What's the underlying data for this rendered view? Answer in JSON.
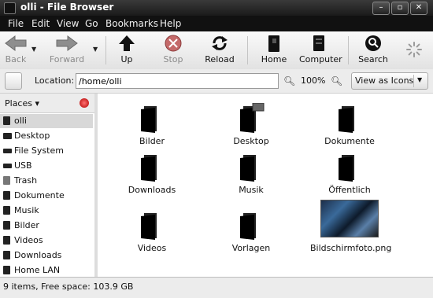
{
  "window": {
    "title": "olli - File Browser"
  },
  "menu": [
    "File",
    "Edit",
    "View",
    "Go",
    "Bookmarks",
    "Help"
  ],
  "toolbar": {
    "back": "Back",
    "forward": "Forward",
    "up": "Up",
    "stop": "Stop",
    "reload": "Reload",
    "home": "Home",
    "computer": "Computer",
    "search": "Search"
  },
  "location": {
    "label": "Location:",
    "path": "/home/olli",
    "zoom": "100%",
    "view_mode": "View as Icons"
  },
  "sidebar": {
    "header": "Places",
    "items": [
      {
        "label": "olli",
        "icon": "home-folder-icon",
        "active": true
      },
      {
        "label": "Desktop",
        "icon": "desktop-icon"
      },
      {
        "label": "File System",
        "icon": "drive-icon"
      },
      {
        "label": "USB",
        "icon": "usb-drive-icon"
      },
      {
        "label": "Trash",
        "icon": "trash-icon"
      },
      {
        "label": "Dokumente",
        "icon": "folder-icon"
      },
      {
        "label": "Musik",
        "icon": "folder-icon"
      },
      {
        "label": "Bilder",
        "icon": "folder-icon"
      },
      {
        "label": "Videos",
        "icon": "folder-icon"
      },
      {
        "label": "Downloads",
        "icon": "folder-icon"
      },
      {
        "label": "Home LAN",
        "icon": "network-icon"
      }
    ]
  },
  "files": [
    {
      "name": "Bilder",
      "type": "folder"
    },
    {
      "name": "Desktop",
      "type": "folder"
    },
    {
      "name": "Dokumente",
      "type": "folder"
    },
    {
      "name": "Downloads",
      "type": "folder"
    },
    {
      "name": "Musik",
      "type": "folder"
    },
    {
      "name": "Öffentlich",
      "type": "folder"
    },
    {
      "name": "Videos",
      "type": "folder"
    },
    {
      "name": "Vorlagen",
      "type": "folder"
    },
    {
      "name": "Bildschirmfoto.png",
      "type": "image"
    }
  ],
  "status": "9 items, Free space: 103.9 GB"
}
